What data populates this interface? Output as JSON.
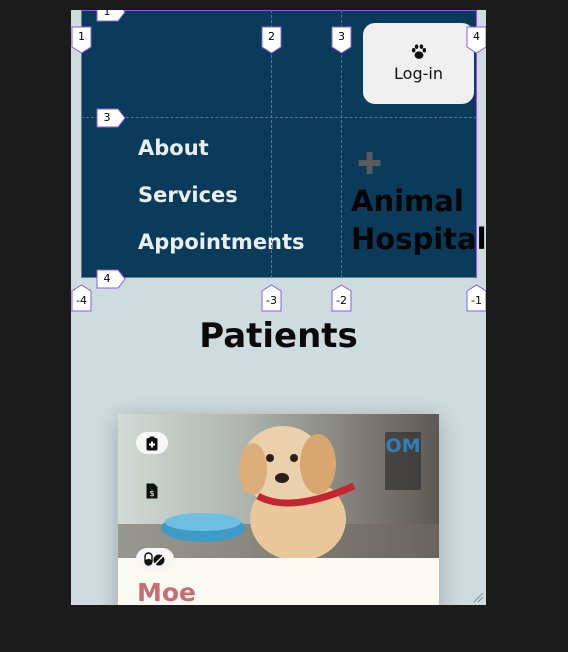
{
  "header": {
    "login_label": "Log-in",
    "nav": [
      "About",
      "Services",
      "Appointments"
    ],
    "brand_line1": "Animal",
    "brand_line2": "Hospital"
  },
  "grid_overlay": {
    "col_labels_top": [
      "1",
      "2",
      "3",
      "4"
    ],
    "row_labels": [
      "3",
      "4"
    ],
    "col_labels_bottom": [
      "-4",
      "-3",
      "-2",
      "-1"
    ]
  },
  "main": {
    "title": "Patients",
    "card": {
      "initials": "OM",
      "name": "Moe"
    }
  },
  "colors": {
    "header_bg": "#0b3b5b",
    "page_bg": "#cfdcdf",
    "name_color": "#c76d74",
    "grid_overlay": "#8a5ee0"
  },
  "icons": [
    "paw-icon",
    "plus-icon",
    "clipboard-medical-icon",
    "invoice-icon",
    "pills-icon",
    "resize-grip-icon"
  ]
}
